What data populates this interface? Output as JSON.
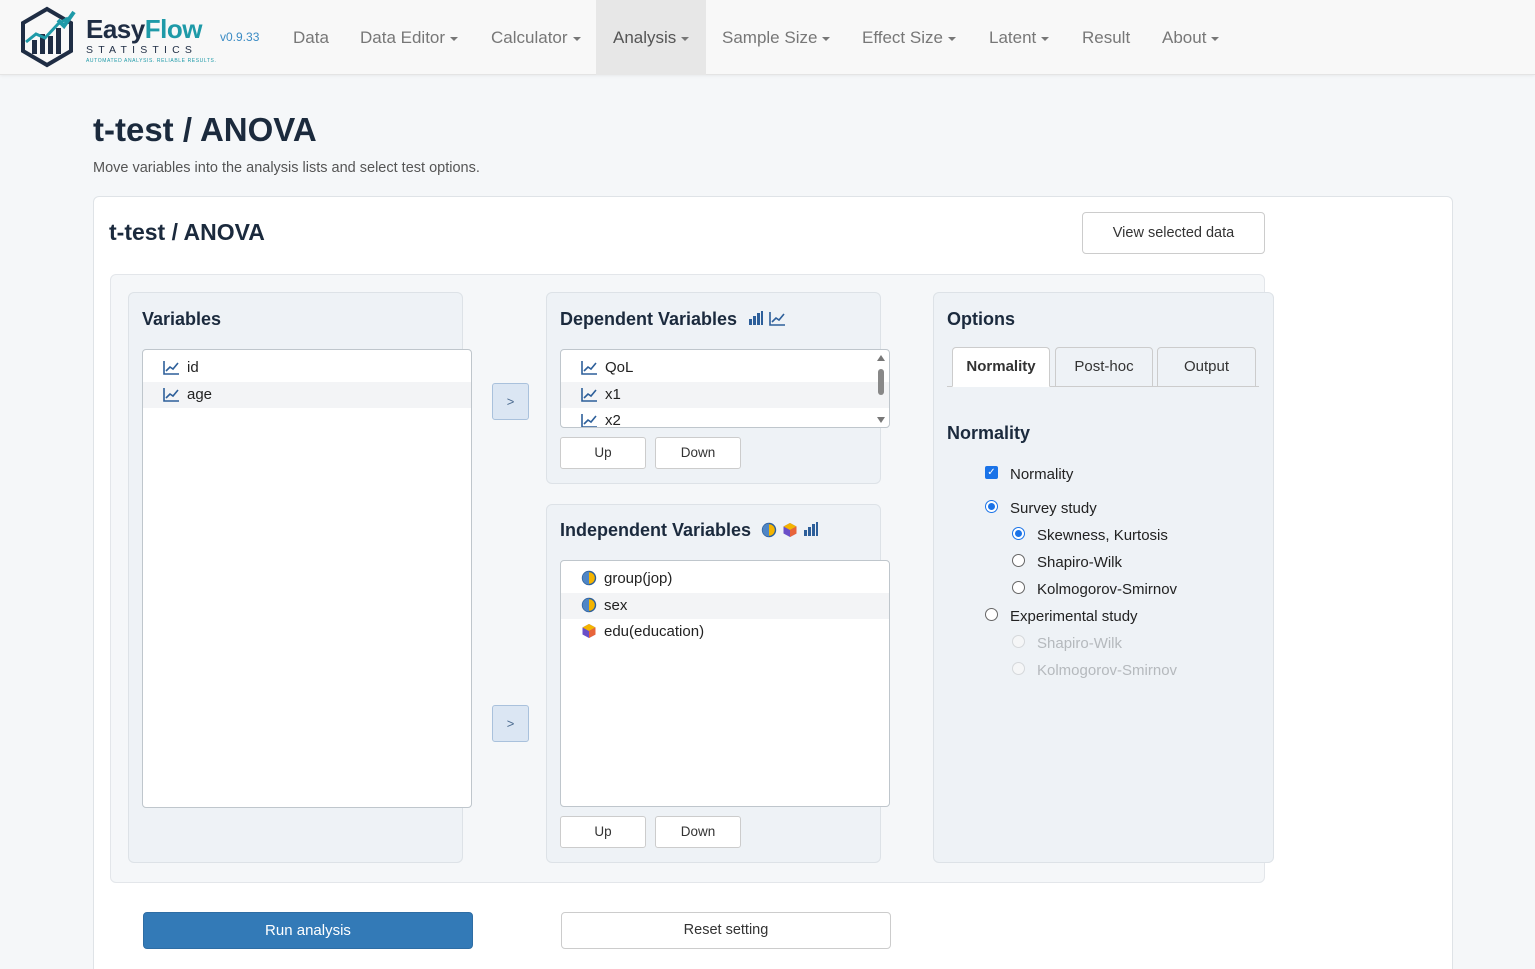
{
  "brand": {
    "name_part1": "Easy",
    "name_part2": "Flow",
    "sub": "STATISTICS",
    "tagline": "AUTOMATED ANALYSIS. RELIABLE RESULTS.",
    "version": "v0.9.33"
  },
  "nav": [
    {
      "label": "Data",
      "dropdown": false
    },
    {
      "label": "Data Editor",
      "dropdown": true
    },
    {
      "label": "Calculator",
      "dropdown": true
    },
    {
      "label": "Analysis",
      "dropdown": true,
      "active": true
    },
    {
      "label": "Sample Size",
      "dropdown": true
    },
    {
      "label": "Effect Size",
      "dropdown": true
    },
    {
      "label": "Latent",
      "dropdown": true
    },
    {
      "label": "Result",
      "dropdown": false
    },
    {
      "label": "About",
      "dropdown": true
    }
  ],
  "page": {
    "title": "t-test / ANOVA",
    "subtitle": "Move variables into the analysis lists and select test options."
  },
  "card": {
    "title": "t-test / ANOVA",
    "view_data_button": "View selected data"
  },
  "variables": {
    "title": "Variables",
    "items": [
      {
        "label": "id",
        "icon": "continuous-icon"
      },
      {
        "label": "age",
        "icon": "continuous-icon"
      }
    ],
    "move_button": ">"
  },
  "dependent": {
    "title": "Dependent Variables",
    "type_icons": [
      "bar-chart-icon",
      "continuous-icon"
    ],
    "items": [
      {
        "label": "QoL",
        "icon": "continuous-icon"
      },
      {
        "label": "x1",
        "icon": "continuous-icon"
      },
      {
        "label": "x2",
        "icon": "continuous-icon"
      }
    ],
    "up_button": "Up",
    "down_button": "Down",
    "move_button": ">"
  },
  "independent": {
    "title": "Independent Variables",
    "type_icons": [
      "nominal-icon",
      "ordinal-icon",
      "bar-chart-icon"
    ],
    "items": [
      {
        "label": "group(jop)",
        "icon": "nominal-icon"
      },
      {
        "label": "sex",
        "icon": "nominal-icon"
      },
      {
        "label": "edu(education)",
        "icon": "ordinal-icon"
      }
    ],
    "up_button": "Up",
    "down_button": "Down"
  },
  "options": {
    "title": "Options",
    "tabs": [
      "Normality",
      "Post-hoc",
      "Output"
    ],
    "active_tab": "Normality",
    "section_title": "Normality",
    "normality_checkbox": {
      "label": "Normality",
      "checked": true
    },
    "survey_study": {
      "label": "Survey study",
      "selected": true
    },
    "survey_methods": [
      {
        "label": "Skewness, Kurtosis",
        "selected": true
      },
      {
        "label": "Shapiro-Wilk",
        "selected": false
      },
      {
        "label": "Kolmogorov-Smirnov",
        "selected": false
      }
    ],
    "experimental_study": {
      "label": "Experimental study",
      "selected": false
    },
    "experimental_methods": [
      {
        "label": "Shapiro-Wilk",
        "disabled": true
      },
      {
        "label": "Kolmogorov-Smirnov",
        "disabled": true
      }
    ]
  },
  "actions": {
    "run": "Run analysis",
    "reset": "Reset setting"
  },
  "colors": {
    "primary": "#337ab7",
    "brand_dark": "#1f2d44",
    "brand_teal": "#1e9aa8",
    "radio_blue": "#1a73e8"
  }
}
